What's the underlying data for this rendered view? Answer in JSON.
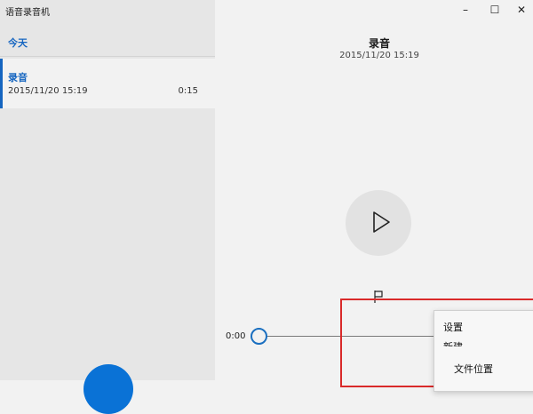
{
  "app": {
    "title": "语音录音机"
  },
  "sidebar": {
    "group_label": "今天",
    "recordings": [
      {
        "title": "录音",
        "date": "2015/11/20 15:19",
        "duration": "0:15"
      }
    ]
  },
  "window_controls": {
    "minimize": "–",
    "maximize": "☐",
    "close": "✕"
  },
  "player": {
    "title": "录音",
    "date": "2015/11/20 15:19",
    "current_time": "0:00",
    "progress": 0
  },
  "context_menu": {
    "items": [
      "设置",
      "新建",
      "文件位置"
    ]
  }
}
